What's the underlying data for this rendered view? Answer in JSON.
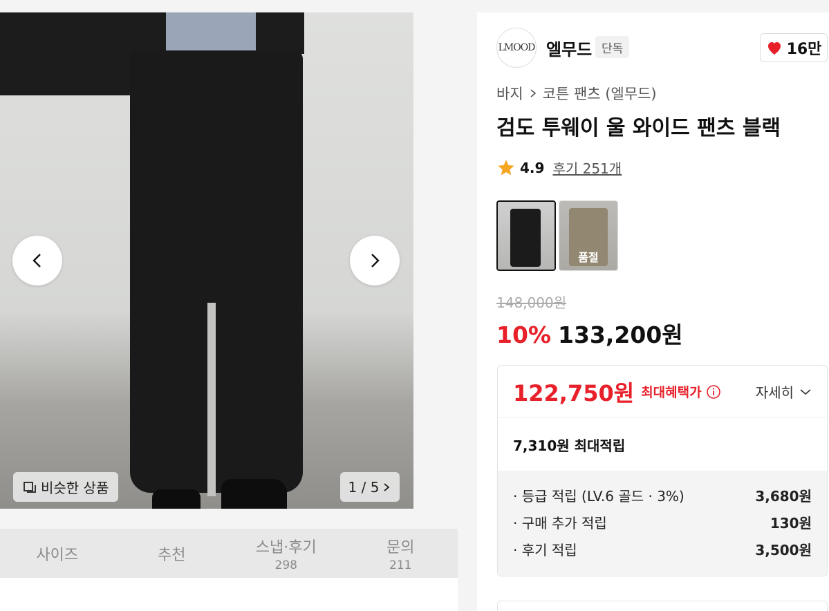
{
  "gallery": {
    "similar_label": "비슷한 상품",
    "counter": "1 / 5"
  },
  "tabs": [
    {
      "label": "사이즈",
      "count": ""
    },
    {
      "label": "추천",
      "count": ""
    },
    {
      "label": "스냅·후기",
      "count": "298"
    },
    {
      "label": "문의",
      "count": "211"
    }
  ],
  "brand": {
    "logo_text": "LMOOD",
    "name": "엘무드",
    "badge": "단독",
    "likes": "16만"
  },
  "breadcrumb": {
    "category": "바지",
    "subcategory": "코튼 팬츠 (엘무드)"
  },
  "product": {
    "title": "검도 투웨이 울 와이드 팬츠 블랙",
    "rating": "4.9",
    "review_link": "후기 251개",
    "soldout_label": "품절",
    "original_price": "148,000원",
    "discount": "10%",
    "price": "133,200원"
  },
  "benefit": {
    "max_price": "122,750원",
    "max_label": "최대혜택가",
    "detail_label": "자세히",
    "points_summary": "7,310원 최대적립",
    "points": [
      {
        "label": "· 등급 적립 (LV.6 골드 · 3%)",
        "value": "3,680원"
      },
      {
        "label": "· 구매 추가 적립",
        "value": "130원"
      },
      {
        "label": "· 후기 적립",
        "value": "3,500원"
      }
    ]
  },
  "colors": {
    "accent_red": "#e8202a",
    "heart": "#e8202a",
    "star": "#f5a623"
  }
}
